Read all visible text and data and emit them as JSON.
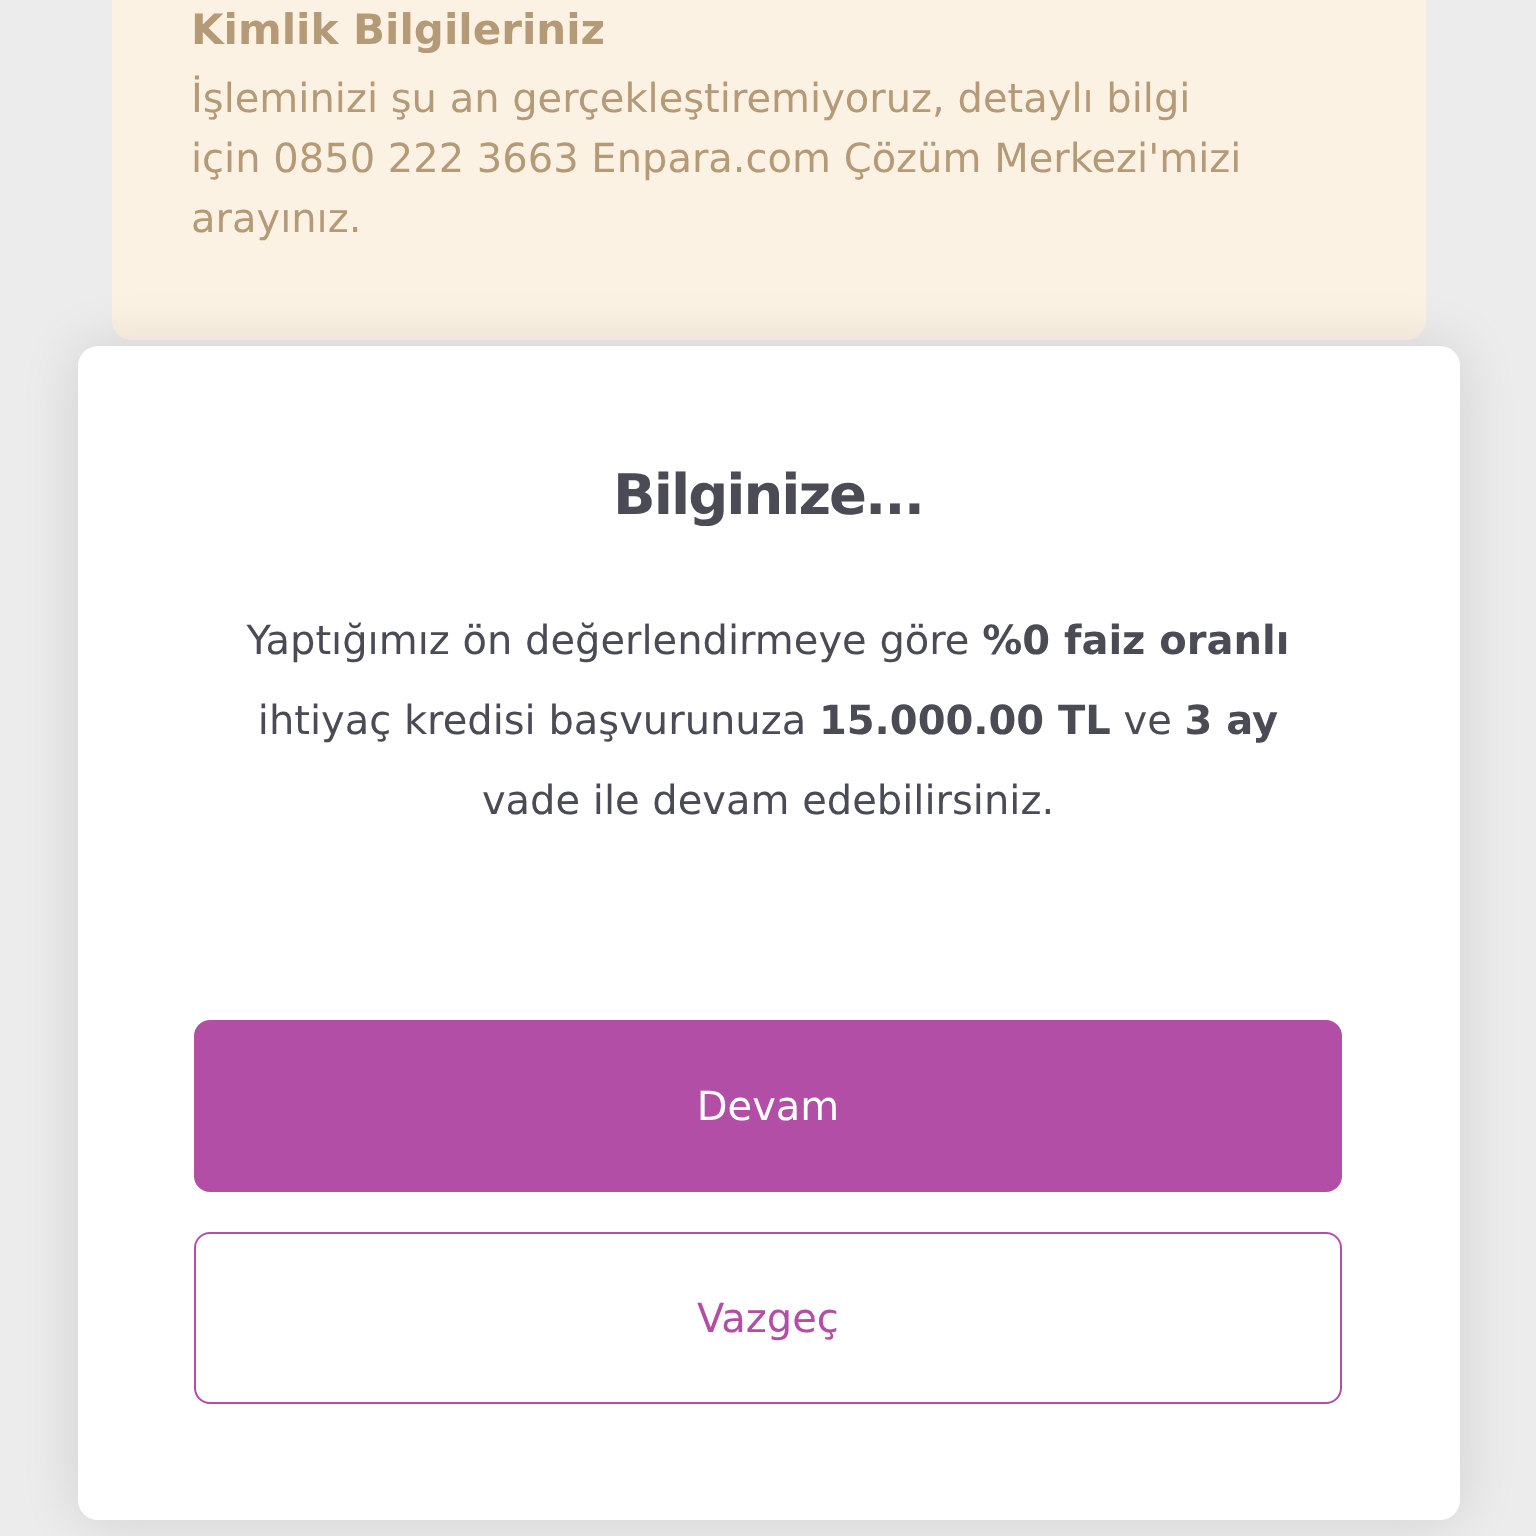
{
  "background_card": {
    "title": "Kimlik Bilgileriniz",
    "message": "İşleminizi şu an gerçekleştiremiyoruz, detaylı bilgi için 0850 222 3663 Enpara.com Çözüm Merkezi'mizi arayınız."
  },
  "dialog": {
    "title": "Bilginize...",
    "message": "Yaptığımız ön değerlendirmeye göre **%0 faiz oranlı** ihtiyaç kredisi başvurunuza **15.000.00 TL** ve **3 ay** vade ile devam edebilirsiniz.",
    "buttons": [
      {
        "label": "Devam",
        "kind": "primary"
      },
      {
        "label": "Vazgeç",
        "kind": "secondary"
      }
    ]
  }
}
